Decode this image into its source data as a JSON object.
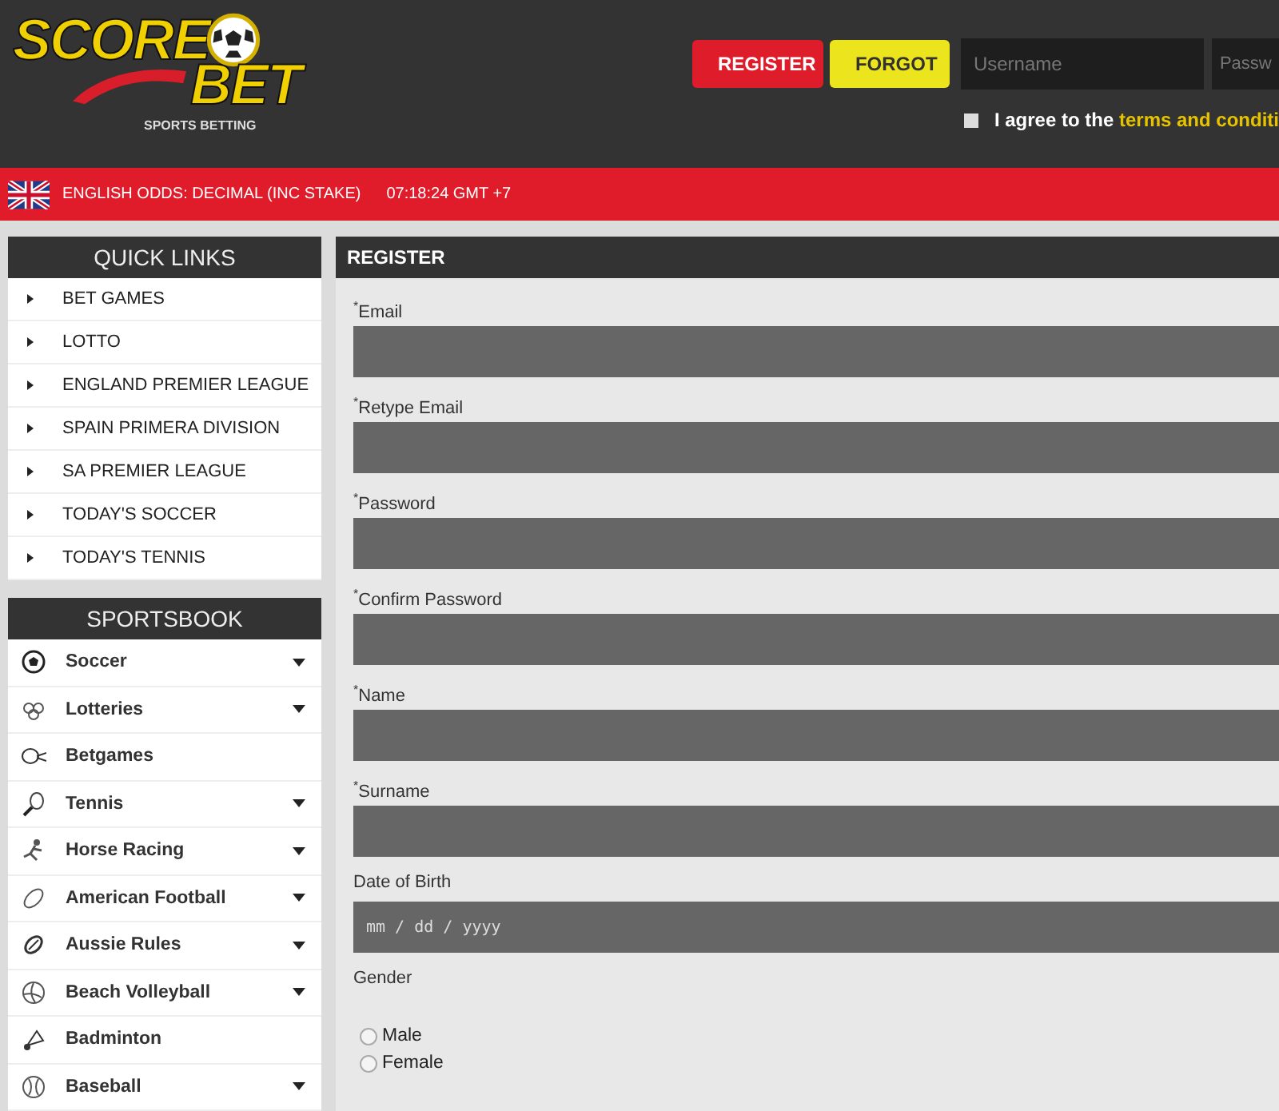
{
  "logo": {
    "line1": "SCORE",
    "line2": "BET",
    "tagline": "SPORTS BETTING"
  },
  "header": {
    "buttons": [
      {
        "label": "REGISTER",
        "kind": "primary"
      },
      {
        "label": "FORGOT",
        "kind": "secondary"
      }
    ],
    "username": {
      "placeholder": "Username"
    },
    "password": {
      "placeholder": "Passw"
    },
    "agree": {
      "checked": false,
      "text": "I agree to the ",
      "link": "terms and conditi"
    }
  },
  "infobar": {
    "odds": "ENGLISH ODDS: DECIMAL (INC STAKE)",
    "time": "07:18:24 GMT +7"
  },
  "quick_links": {
    "title": "QUICK LINKS",
    "items": [
      "BET GAMES",
      "LOTTO",
      "ENGLAND PREMIER LEAGUE",
      "SPAIN PRIMERA DIVISION",
      "SA PREMIER LEAGUE",
      "TODAY'S SOCCER",
      "TODAY'S TENNIS"
    ]
  },
  "sportsbook": {
    "title": "SPORTSBOOK",
    "items": [
      {
        "label": "Soccer",
        "expandable": true
      },
      {
        "label": "Lotteries",
        "expandable": true
      },
      {
        "label": "Betgames",
        "expandable": false
      },
      {
        "label": "Tennis",
        "expandable": true
      },
      {
        "label": "Horse Racing",
        "expandable": true
      },
      {
        "label": "American Football",
        "expandable": true
      },
      {
        "label": "Aussie Rules",
        "expandable": true
      },
      {
        "label": "Beach Volleyball",
        "expandable": true
      },
      {
        "label": "Badminton",
        "expandable": false
      },
      {
        "label": "Baseball",
        "expandable": true
      }
    ]
  },
  "register": {
    "title": "REGISTER",
    "fields": [
      {
        "label": "$^{*}$Email",
        "kind": "text"
      },
      {
        "label": "$^{*}$Retype Email",
        "kind": "text"
      },
      {
        "label": "$^{*}$Password",
        "kind": "text"
      },
      {
        "label": "$^{*}$Confirm Password",
        "kind": "text"
      },
      {
        "label": "$^{*}$Name",
        "kind": "text"
      },
      {
        "label": "$^{*}$Surname",
        "kind": "text"
      },
      {
        "label": "Date of Birth",
        "kind": "date",
        "placeholder": "mm / dd / yyyy"
      },
      {
        "label": "Gender",
        "kind": "radio",
        "options": [
          {
            "label": "Male",
            "selected": false
          },
          {
            "label": "Female",
            "selected": false
          }
        ]
      }
    ]
  }
}
